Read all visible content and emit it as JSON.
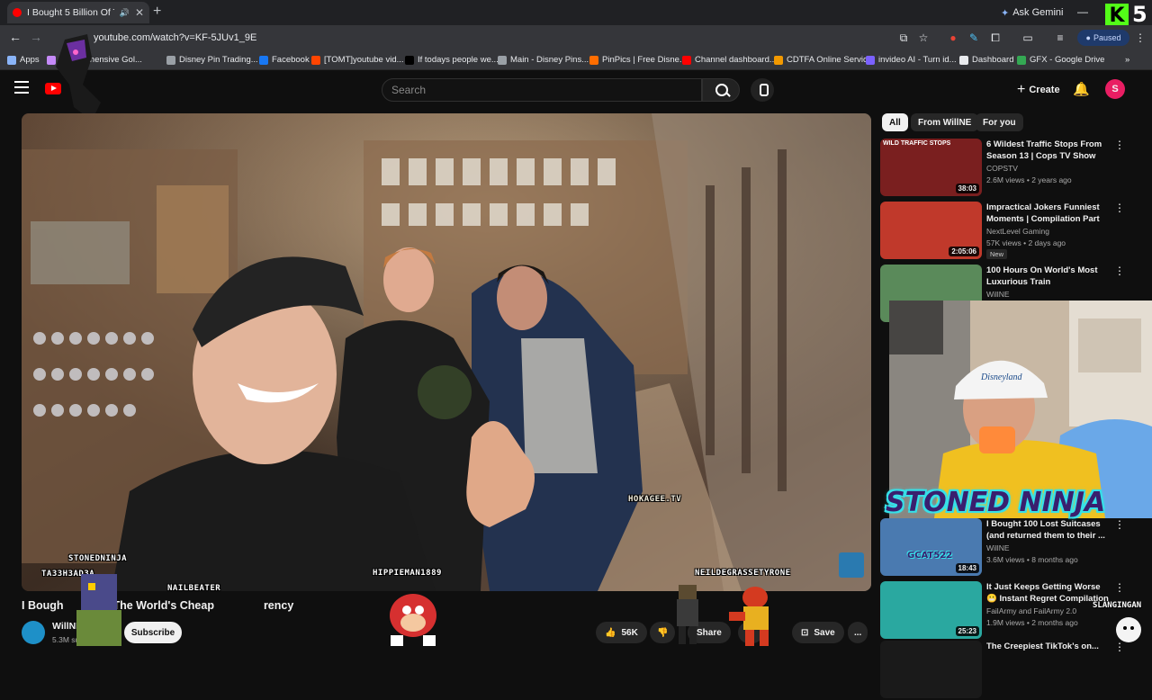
{
  "browser": {
    "tab_title": "I Bought 5 Billion Of The W",
    "new_tab": "+",
    "gemini_label": "Ask Gemini",
    "kick_num": "5",
    "url": "youtube.com/watch?v=KF-5JUv1_9E",
    "profile_status": "Paused",
    "bookmarks": [
      {
        "label": "Apps",
        "color": "#8ab4f8"
      },
      {
        "label": "Comprehensive Gol...",
        "color": "#c58af9"
      },
      {
        "label": "Disney Pin Trading...",
        "color": "#9aa0a6"
      },
      {
        "label": "Facebook",
        "color": "#1877f2"
      },
      {
        "label": "[TOMT]youtube vid...",
        "color": "#ff4500"
      },
      {
        "label": "If todays people we...",
        "color": "#000000"
      },
      {
        "label": "Main - Disney Pins...",
        "color": "#9aa0a6"
      },
      {
        "label": "PinPics | Free Disne...",
        "color": "#ff6d00"
      },
      {
        "label": "Channel dashboard...",
        "color": "#ff0000"
      },
      {
        "label": "CDTFA Online Servic...",
        "color": "#f29900"
      },
      {
        "label": "invideo AI - Turn id...",
        "color": "#7b61ff"
      },
      {
        "label": "Dashboard",
        "color": "#e8eaed"
      },
      {
        "label": "GFX - Google Drive",
        "color": "#34a853"
      }
    ]
  },
  "yt": {
    "search_placeholder": "Search",
    "create_label": "Create",
    "avatar_letter": "S"
  },
  "video": {
    "title_left": "I Bough",
    "title_right": "The World's Cheap",
    "title_end": "rency",
    "watermark": "HOKAGEE.TV",
    "overlay_names": [
      "STONEDNINJA",
      "TA33H3AD3A",
      "NAILBEATER",
      "HIPPIEMAN1889",
      "NEILDEGRASSETYRONE"
    ],
    "channel_name": "WillNE",
    "channel_subs": "5.3M subscribers",
    "subscribe_label": "Subscribe",
    "likes": "56K",
    "share_label": "Share",
    "save_label": "Save",
    "more": "..."
  },
  "sidebar": {
    "chips": [
      "All",
      "From WillNE",
      "For you"
    ],
    "recs": [
      {
        "title": "6 Wildest Traffic Stops From Season 13 | Cops TV Show",
        "channel": "COPSTV",
        "meta": "2.6M views • 2 years ago",
        "dur": "38:03",
        "thumb_text": "WILD TRAFFIC STOPS",
        "thumb_color": "#7a1f1f"
      },
      {
        "title": "Impractical Jokers Funniest Moments | Compilation Part 6...",
        "channel": "NextLevel Gaming",
        "meta": "57K views • 2 days ago",
        "dur": "2:05:06",
        "badge": "New",
        "thumb_color": "#c0392b"
      },
      {
        "title": "100 Hours On World's Most Luxurious Train",
        "channel": "WillNE",
        "meta": "",
        "dur": "",
        "thumb_color": "#5a8a5a"
      },
      {
        "title": "I Bought 100 Lost Suitcases (and returned them to their ...",
        "channel": "WillNE",
        "meta": "3.6M views • 8 months ago",
        "dur": "18:43",
        "thumb_color": "#4a7ab0"
      },
      {
        "title": "It Just Keeps Getting Worse 😬 Instant Regret Compilation",
        "channel": "FailArmy and FailArmy 2.0",
        "meta": "1.9M views • 2 months ago",
        "dur": "25:23",
        "thumb_color": "#2aa8a0"
      },
      {
        "title": "The Creepiest TikTok's on...",
        "channel": "",
        "meta": "",
        "dur": "",
        "thumb_color": "#1a1a1a"
      }
    ]
  },
  "stream": {
    "webcam_name": "STONED NINJA",
    "slang": "SLANGINGAN",
    "cap_text": "Disneyland",
    "sticker_text": "GCAT522"
  }
}
